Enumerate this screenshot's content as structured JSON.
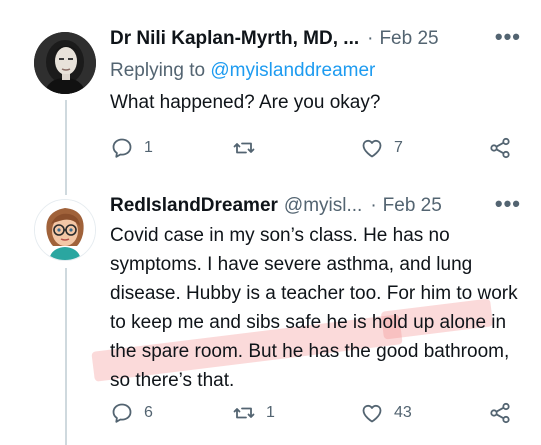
{
  "tweets": [
    {
      "author": {
        "name": "Dr Nili Kaplan-Myrth, MD, ...",
        "handle": "",
        "avatar_icon": "profile-photo-woman"
      },
      "date": "Feb 25",
      "separator": "·",
      "more_label": "•••",
      "replying_prefix": "Replying to",
      "replying_to": "@myislanddreamer",
      "text": "What happened? Are you okay?",
      "stats": {
        "replies": "1",
        "retweets": "",
        "likes": "7"
      }
    },
    {
      "author": {
        "name": "RedIslandDreamer",
        "handle": "@myisl...",
        "avatar_icon": "cartoon-avatar-glasses"
      },
      "date": "Feb 25",
      "separator": "·",
      "more_label": "•••",
      "text": "Covid case in my son’s class. He has no symptoms. I have severe asthma, and lung disease. Hubby is a teacher too. For him to work to keep me and sibs safe he is hold up alone in the spare room. But he has the good bathroom, so there’s that.",
      "stats": {
        "replies": "6",
        "retweets": "1",
        "likes": "43"
      }
    }
  ],
  "colors": {
    "text_primary": "#0f1419",
    "text_secondary": "#536471",
    "accent": "#1d9bf0",
    "thread_line": "#cfd9de",
    "highlight": "#f48c8c"
  },
  "icons": [
    "reply-icon",
    "retweet-icon",
    "like-icon",
    "share-icon",
    "more-icon"
  ]
}
